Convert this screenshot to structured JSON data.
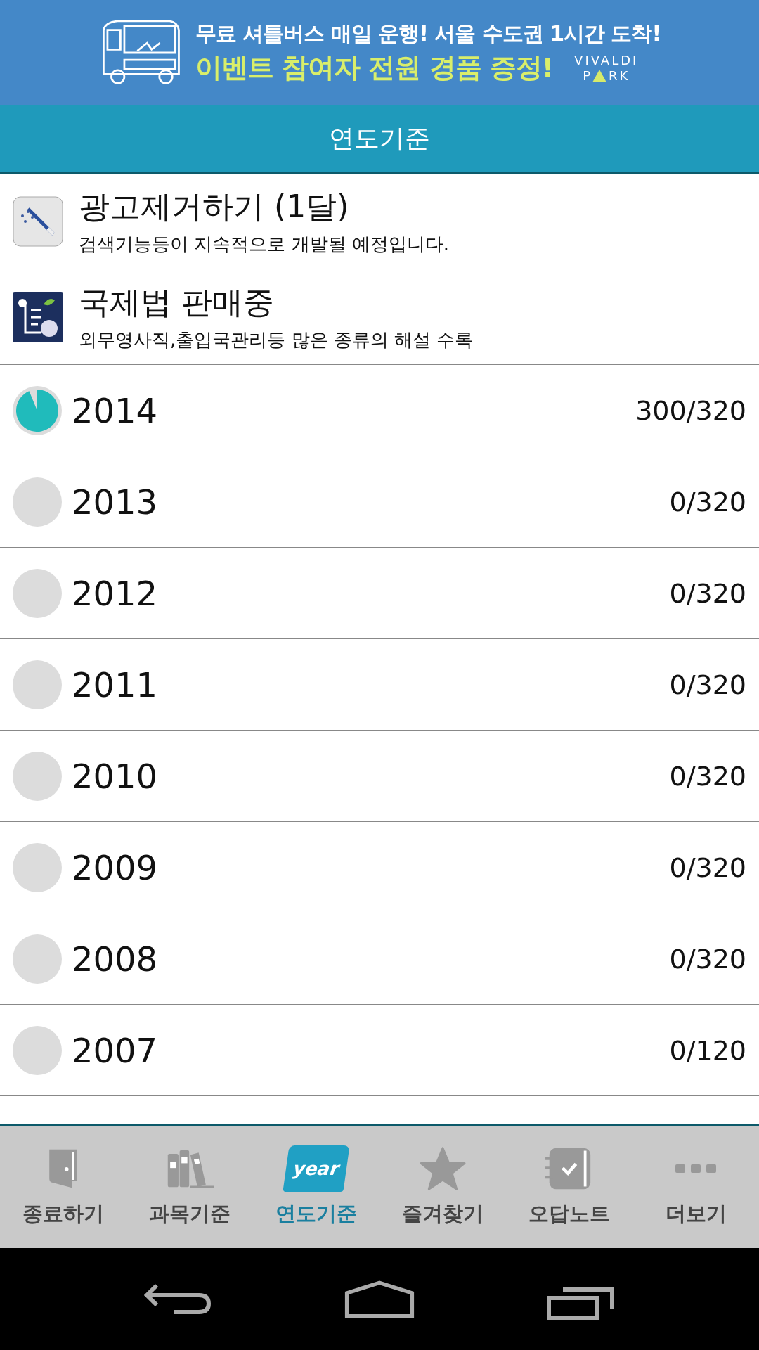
{
  "banner": {
    "line1": "무료 셔틀버스 매일 운행! 서울 수도권 1시간 도착!",
    "line2": "이벤트 참여자 전원 경품 증정!",
    "logo_top": "VIVALDI",
    "logo_left": "P",
    "logo_right": "RK"
  },
  "title": "연도기준",
  "promos": [
    {
      "kind": "wand",
      "title": "광고제거하기 (1달)",
      "subtitle": "검색기능등이 지속적으로 개발될 예정입니다."
    },
    {
      "kind": "law",
      "title": "국제법 판매중",
      "subtitle": "외무영사직,출입국관리등 많은 종류의 해설 수록"
    }
  ],
  "years": [
    {
      "year": "2014",
      "count": "300/320"
    },
    {
      "year": "2013",
      "count": "0/320"
    },
    {
      "year": "2012",
      "count": "0/320"
    },
    {
      "year": "2011",
      "count": "0/320"
    },
    {
      "year": "2010",
      "count": "0/320"
    },
    {
      "year": "2009",
      "count": "0/320"
    },
    {
      "year": "2008",
      "count": "0/320"
    },
    {
      "year": "2007",
      "count": "0/120"
    }
  ],
  "tabs": [
    {
      "kind": "door",
      "label": "종료하기",
      "selected": false
    },
    {
      "kind": "books",
      "label": "과목기준",
      "selected": false
    },
    {
      "kind": "calendar",
      "label": "연도기준",
      "selected": true,
      "icon_text": "year"
    },
    {
      "kind": "star",
      "label": "즐겨찾기",
      "selected": false
    },
    {
      "kind": "notebook",
      "label": "오답노트",
      "selected": false
    },
    {
      "kind": "more",
      "label": "더보기",
      "selected": false
    }
  ]
}
